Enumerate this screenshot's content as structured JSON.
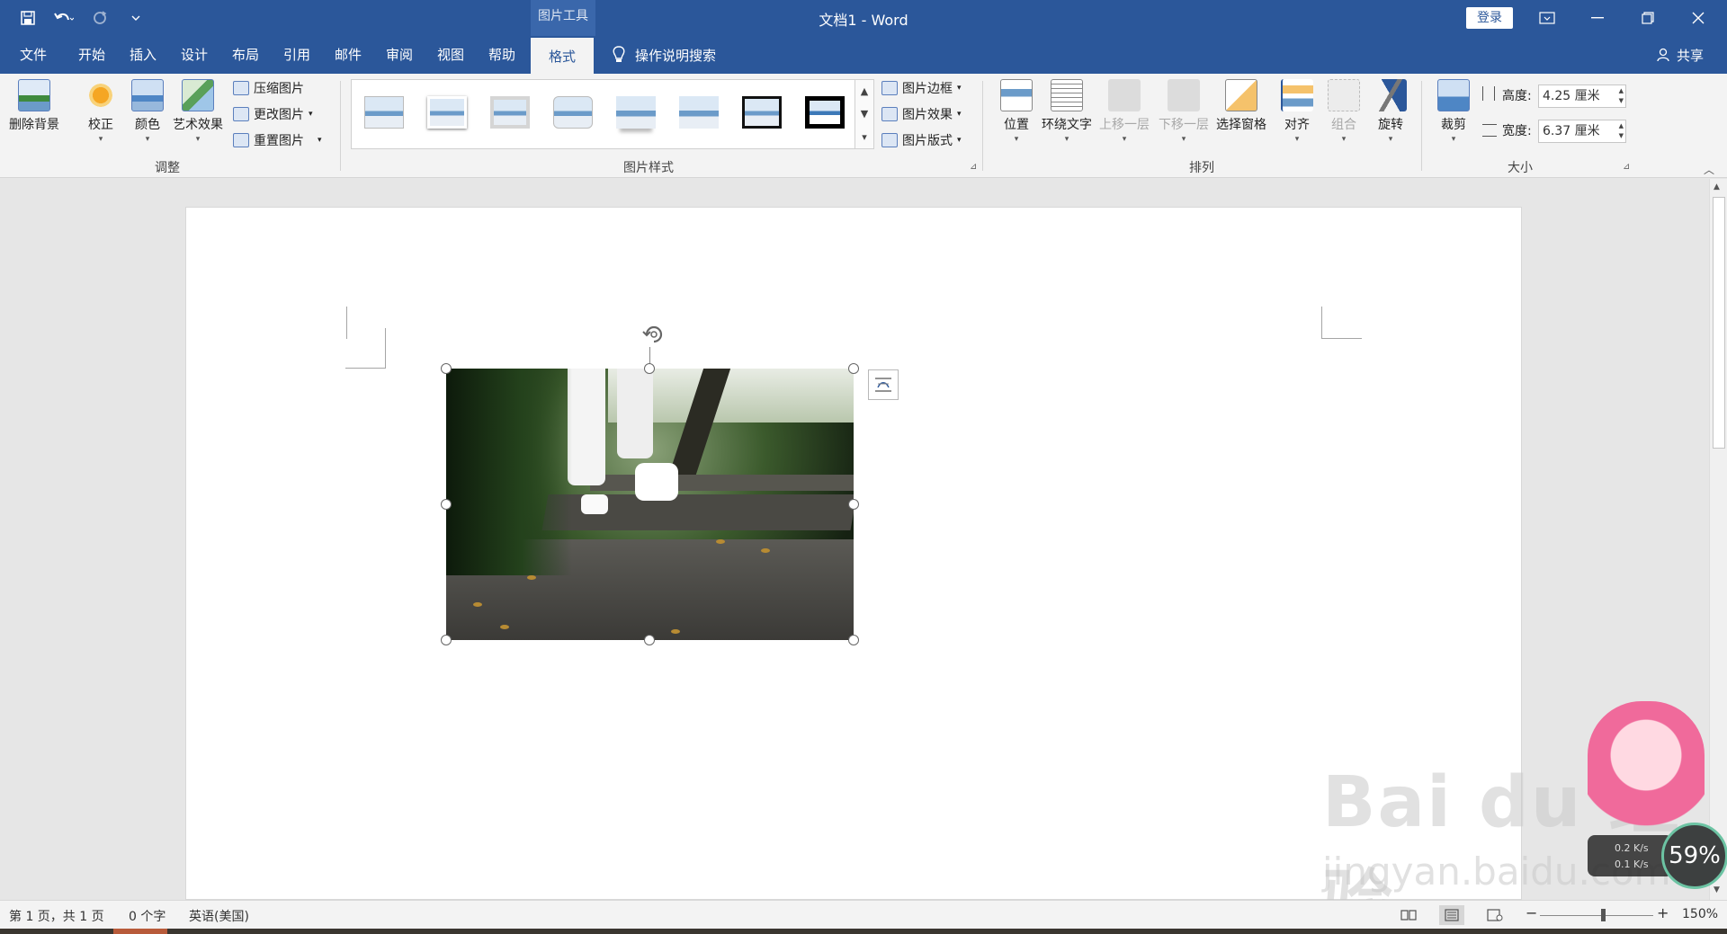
{
  "titlebar": {
    "doc_title": "文档1  -  Word",
    "contextual_header": "图片工具",
    "login_label": "登录",
    "qat_icons": [
      "save-icon",
      "undo-icon",
      "redo-icon",
      "customize-qat-icon"
    ]
  },
  "tabs": {
    "items": [
      {
        "label": "文件"
      },
      {
        "label": "开始"
      },
      {
        "label": "插入"
      },
      {
        "label": "设计"
      },
      {
        "label": "布局"
      },
      {
        "label": "引用"
      },
      {
        "label": "邮件"
      },
      {
        "label": "审阅"
      },
      {
        "label": "视图"
      },
      {
        "label": "帮助"
      },
      {
        "label": "格式"
      }
    ],
    "active": "格式",
    "tell_me": "操作说明搜索",
    "share": "共享"
  },
  "ribbon": {
    "adjust": {
      "label": "调整",
      "remove_bg": "删除背景",
      "corrections": "校正",
      "color": "颜色",
      "artistic": "艺术效果",
      "compress": "压缩图片",
      "change": "更改图片",
      "reset": "重置图片"
    },
    "styles": {
      "label": "图片样式",
      "border": "图片边框",
      "effects": "图片效果",
      "layout": "图片版式"
    },
    "arrange": {
      "label": "排列",
      "position": "位置",
      "wrap_text": "环绕文字",
      "bring_forward": "上移一层",
      "send_backward": "下移一层",
      "selection_pane": "选择窗格",
      "align": "对齐",
      "group": "组合",
      "rotate": "旋转"
    },
    "size": {
      "label": "大小",
      "crop": "裁剪",
      "height_label": "高度:",
      "height_value": "4.25 厘米",
      "width_label": "宽度:",
      "width_value": "6.37 厘米"
    }
  },
  "statusbar": {
    "page": "第 1 页，共 1 页",
    "words": "0 个字",
    "language": "英语(美国)",
    "zoom_minus": "−",
    "zoom_plus": "+",
    "zoom": "150%"
  },
  "overlay": {
    "watermark": "Bai du 经验",
    "watermark_sub": "jingyan.baidu.com",
    "upload_speed": "0.2 K/s",
    "download_speed": "0.1 K/s",
    "percent": "59%"
  }
}
